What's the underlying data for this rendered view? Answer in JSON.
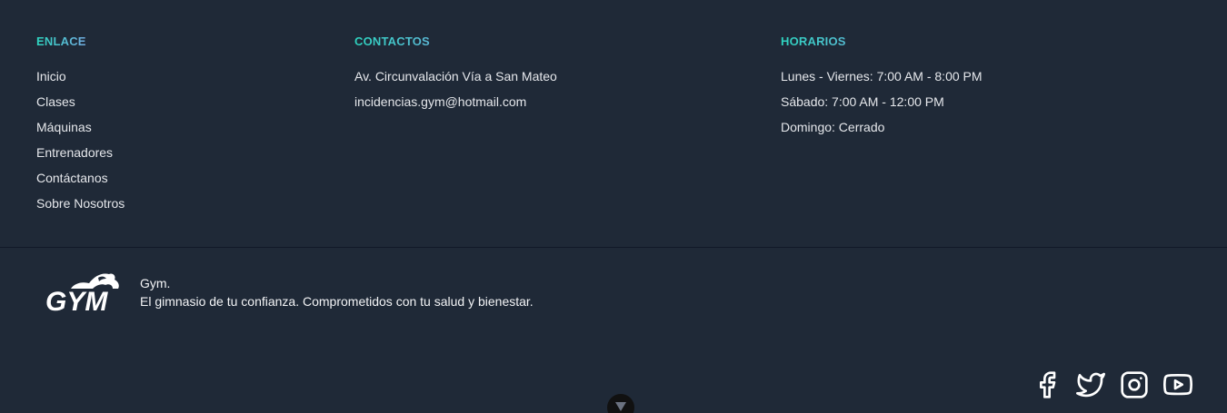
{
  "footer": {
    "enlace": {
      "title": "ENLACE",
      "links": [
        "Inicio",
        "Clases",
        "Máquinas",
        "Entrenadores",
        "Contáctanos",
        "Sobre Nosotros"
      ]
    },
    "contactos": {
      "title": "CONTACTOS",
      "items": [
        "Av. Circunvalación Vía a San Mateo",
        "incidencias.gym@hotmail.com"
      ]
    },
    "horarios": {
      "title": "HORARIOS",
      "items": [
        "Lunes - Viernes: 7:00 AM - 8:00 PM",
        "Sábado: 7:00 AM - 12:00 PM",
        "Domingo: Cerrado"
      ]
    },
    "brand": {
      "logo_text": "GYM",
      "name": "Gym.",
      "tagline": "El gimnasio de tu confianza. Comprometidos con tu salud y bienestar."
    },
    "social": [
      "facebook-icon",
      "twitter-icon",
      "instagram-icon",
      "youtube-icon"
    ],
    "colors": {
      "background": "#1f2937",
      "title_gradient_start": "#2dd4bf",
      "title_gradient_end": "#a78bfa",
      "text": "#e5e7eb"
    }
  }
}
